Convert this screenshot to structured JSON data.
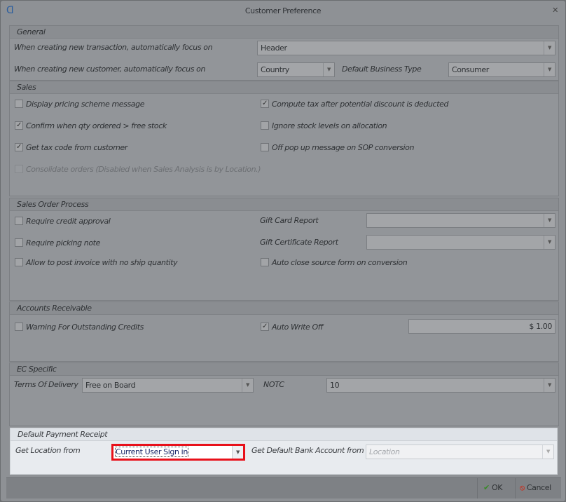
{
  "window": {
    "title": "Customer Preference",
    "app_icon": "app-logo-icon",
    "close_icon": "close-icon"
  },
  "general": {
    "header": "General",
    "transaction_label": "When creating new transaction, automatically focus on",
    "transaction_value": "Header",
    "customer_label": "When creating new customer, automatically focus on",
    "customer_value": "Country",
    "business_type_label": "Default Business Type",
    "business_type_value": "Consumer"
  },
  "sales": {
    "header": "Sales",
    "items": [
      {
        "label": "Display pricing scheme message",
        "checked": false
      },
      {
        "label": "Compute tax after potential discount is deducted",
        "checked": true
      },
      {
        "label": "Confirm when qty ordered > free stock",
        "checked": true
      },
      {
        "label": "Ignore stock levels on allocation",
        "checked": false
      },
      {
        "label": "Get tax code from customer",
        "checked": true
      },
      {
        "label": "Off pop up message on SOP conversion",
        "checked": false
      },
      {
        "label": "Consolidate orders (Disabled when Sales Analysis is by Location.)",
        "checked": false,
        "disabled": true
      }
    ]
  },
  "sop": {
    "header": "Sales Order Process",
    "credit": "Require credit approval",
    "picking": "Require picking note",
    "post_invoice": "Allow to post invoice with no ship quantity",
    "gift_card": "Gift Card Report",
    "gift_cert": "Gift Certificate Report",
    "auto_close": "Auto close source form on conversion"
  },
  "ar": {
    "header": "Accounts Receivable",
    "warning": "Warning For Outstanding Credits",
    "auto_write_off": "Auto Write Off",
    "amount": "$ 1.00"
  },
  "ec": {
    "header": "EC Specific",
    "terms_label": "Terms Of Delivery",
    "terms_value": "Free on Board",
    "notc_label": "NOTC",
    "notc_value": "10"
  },
  "payment": {
    "header": "Default Payment Receipt",
    "location_label": "Get Location from",
    "location_value": "Current User Sign in",
    "bank_label": "Get Default Bank Account from",
    "bank_value": "Location"
  },
  "footer": {
    "ok": "OK",
    "cancel": "Cancel"
  },
  "colors": {
    "highlight": "#e8101a",
    "ok_check": "#3a8a2a",
    "cancel": "#c0392b"
  }
}
